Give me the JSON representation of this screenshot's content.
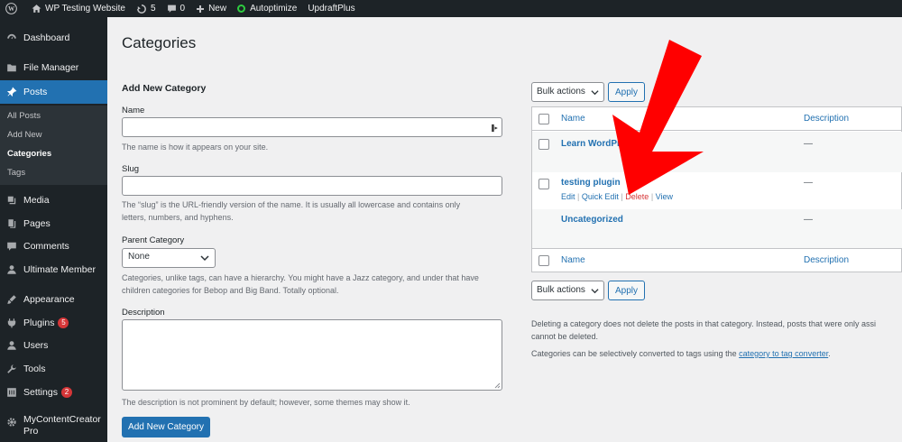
{
  "admin_bar": {
    "site_name": "WP Testing Website",
    "updates_count": "5",
    "comments_count": "0",
    "new_label": "New",
    "autoptimize_label": "Autoptimize",
    "updraft_label": "UpdraftPlus"
  },
  "sidebar": {
    "items": [
      {
        "label": "Dashboard",
        "icon": "dashboard-icon"
      },
      {
        "label": "File Manager",
        "icon": "folder-icon"
      },
      {
        "label": "Posts",
        "icon": "pin-icon"
      },
      {
        "label": "Media",
        "icon": "media-icon"
      },
      {
        "label": "Pages",
        "icon": "pages-icon"
      },
      {
        "label": "Comments",
        "icon": "comment-icon"
      },
      {
        "label": "Ultimate Member",
        "icon": "user-icon"
      },
      {
        "label": "Appearance",
        "icon": "brush-icon"
      },
      {
        "label": "Plugins",
        "icon": "plugin-icon",
        "badge": "5"
      },
      {
        "label": "Users",
        "icon": "users-icon"
      },
      {
        "label": "Tools",
        "icon": "wrench-icon"
      },
      {
        "label": "Settings",
        "icon": "settings-icon",
        "badge": "2"
      },
      {
        "label": "MyContentCreator",
        "label2": "Pro",
        "icon": "gear-icon"
      }
    ],
    "posts_submenu": [
      "All Posts",
      "Add New",
      "Categories",
      "Tags"
    ]
  },
  "page_title": "Categories",
  "form": {
    "heading": "Add New Category",
    "name_label": "Name",
    "name_value": "",
    "name_help": "The name is how it appears on your site.",
    "slug_label": "Slug",
    "slug_value": "",
    "slug_help_1": "The “slug” is the URL-friendly version of the name. It is usually all lowercase and contains only",
    "slug_help_2": "letters, numbers, and hyphens.",
    "parent_label": "Parent Category",
    "parent_value": "None",
    "parent_help_1": "Categories, unlike tags, can have a hierarchy. You might have a Jazz category, and under that have",
    "parent_help_2": "children categories for Bebop and Big Band. Totally optional.",
    "description_label": "Description",
    "description_value": "",
    "description_help": "The description is not prominent by default; however, some themes may show it.",
    "submit_label": "Add New Category"
  },
  "list": {
    "bulk_actions_label": "Bulk actions",
    "apply_label": "Apply",
    "col_name": "Name",
    "col_description": "Description",
    "rows": [
      {
        "name": "Learn WordPress",
        "description": "—"
      },
      {
        "name": "testing plugin",
        "description": "—",
        "actions": [
          "Edit",
          "Quick Edit",
          "Delete",
          "View"
        ]
      },
      {
        "name": "Uncategorized",
        "description": "—"
      }
    ],
    "separator": "|"
  },
  "notes": {
    "line1": "Deleting a category does not delete the posts in that category. Instead, posts that were only assi",
    "line2": "cannot be deleted.",
    "line3_prefix": "Categories can be selectively converted to tags using the ",
    "line3_link": "category to tag converter",
    "line3_suffix": "."
  },
  "colors": {
    "accent": "#2271b1",
    "admin_bg": "#1d2327",
    "danger": "#d63638",
    "annotation_arrow": "#ff0000"
  }
}
